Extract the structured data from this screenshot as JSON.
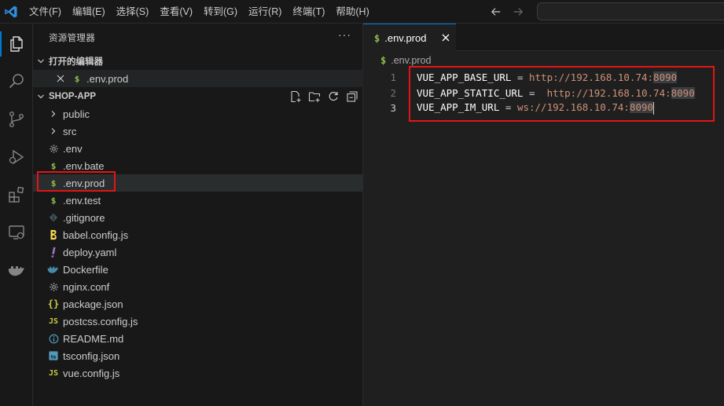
{
  "menu": [
    "文件(F)",
    "编辑(E)",
    "选择(S)",
    "查看(V)",
    "转到(G)",
    "运行(R)",
    "终端(T)",
    "帮助(H)"
  ],
  "sidebar": {
    "title": "资源管理器",
    "more": "···",
    "open_editors": {
      "label": "打开的编辑器",
      "items": [
        {
          "icon": "$",
          "name": ".env.prod"
        }
      ]
    },
    "project": {
      "label": "SHOP-APP",
      "items": [
        {
          "type": "folder",
          "name": "public"
        },
        {
          "type": "folder",
          "name": "src"
        },
        {
          "type": "file",
          "icon": "gear",
          "name": ".env"
        },
        {
          "type": "file",
          "icon": "$",
          "name": ".env.bate"
        },
        {
          "type": "file",
          "icon": "$",
          "name": ".env.prod",
          "selected": true
        },
        {
          "type": "file",
          "icon": "$",
          "name": ".env.test"
        },
        {
          "type": "file",
          "icon": "git",
          "name": ".gitignore"
        },
        {
          "type": "file",
          "icon": "babel",
          "name": "babel.config.js"
        },
        {
          "type": "file",
          "icon": "yaml",
          "name": "deploy.yaml"
        },
        {
          "type": "file",
          "icon": "docker",
          "name": "Dockerfile"
        },
        {
          "type": "file",
          "icon": "gear",
          "name": "nginx.conf"
        },
        {
          "type": "file",
          "icon": "json",
          "name": "package.json"
        },
        {
          "type": "file",
          "icon": "js",
          "name": "postcss.config.js"
        },
        {
          "type": "file",
          "icon": "info",
          "name": "README.md"
        },
        {
          "type": "file",
          "icon": "ts",
          "name": "tsconfig.json"
        },
        {
          "type": "file",
          "icon": "js",
          "name": "vue.config.js"
        }
      ]
    }
  },
  "editor": {
    "tab": {
      "icon": "$",
      "name": ".env.prod"
    },
    "breadcrumb": {
      "icon": "$",
      "name": ".env.prod"
    },
    "lines": [
      {
        "num": "1",
        "key": "VUE_APP_BASE_URL",
        "eq": " = ",
        "value": "http://192.168.10.74:",
        "port": "8090"
      },
      {
        "num": "2",
        "key": "VUE_APP_STATIC_URL",
        "eq": " =  ",
        "value": "http://192.168.10.74:",
        "port": "8090"
      },
      {
        "num": "3",
        "key": "VUE_APP_IM_URL",
        "eq": " = ",
        "value": "ws://192.168.10.74:",
        "port": "8090"
      }
    ]
  },
  "colors": {
    "accent": "#0078d4",
    "env_icon": "#8dc149",
    "string": "#ce9178",
    "annotation": "#e51414"
  }
}
